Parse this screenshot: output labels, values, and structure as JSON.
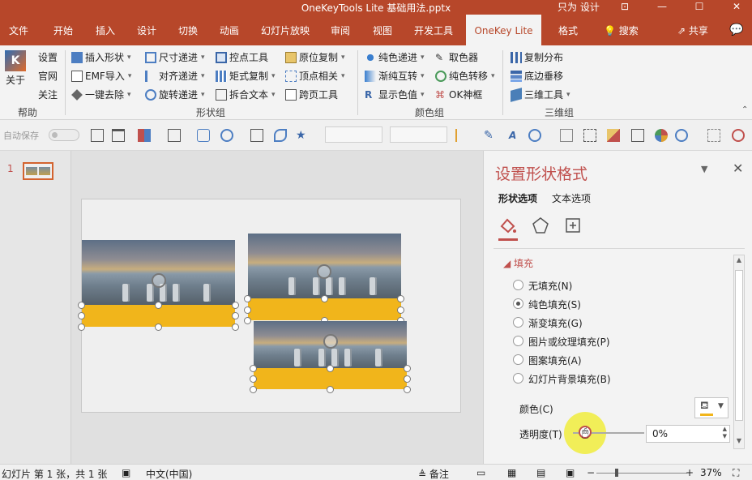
{
  "window": {
    "title": "OneKeyTools Lite 基础用法.pptx",
    "user": "只为 设计",
    "buttons": [
      "⊡",
      "—",
      "☐",
      "✕"
    ]
  },
  "tabs": [
    "文件",
    "开始",
    "插入",
    "设计",
    "切换",
    "动画",
    "幻灯片放映",
    "审阅",
    "视图",
    "开发工具",
    "OneKey Lite",
    "格式"
  ],
  "active_tab": "OneKey Lite",
  "tell_me": "搜索",
  "share": "共享",
  "ribbon": {
    "help_group": {
      "big_button": "关于",
      "items": [
        "设置",
        "官网",
        "关注"
      ],
      "label": "帮助"
    },
    "shape_group": {
      "col1": [
        "插入形状",
        "EMF导入",
        "一键去除"
      ],
      "col2": [
        "尺寸递进",
        "对齐递进",
        "旋转递进"
      ],
      "col3": [
        "控点工具",
        "矩式复制",
        "拆合文本"
      ],
      "col4": [
        "原位复制",
        "顶点相关",
        "跨页工具"
      ],
      "label": "形状组"
    },
    "color_group": {
      "col1": [
        "纯色递进",
        "渐纯互转",
        "显示色值"
      ],
      "col2": [
        "取色器",
        "纯色转移",
        "OK神框"
      ],
      "label": "颜色组"
    },
    "three_d_group": {
      "items": [
        "复制分布",
        "底边垂移",
        "三维工具"
      ],
      "label": "三维组"
    }
  },
  "qat": {
    "autosave_label": "自动保存"
  },
  "thumbnails": {
    "slide_number": "1"
  },
  "format_pane": {
    "title": "设置形状格式",
    "tabs": [
      "形状选项",
      "文本选项"
    ],
    "section": "填充",
    "fill_options": [
      {
        "label": "无填充(N)",
        "selected": false
      },
      {
        "label": "纯色填充(S)",
        "selected": true
      },
      {
        "label": "渐变填充(G)",
        "selected": false
      },
      {
        "label": "图片或纹理填充(P)",
        "selected": false
      },
      {
        "label": "图案填充(A)",
        "selected": false
      },
      {
        "label": "幻灯片背景填充(B)",
        "selected": false
      }
    ],
    "color_label": "颜色(C)",
    "transparency_label": "透明度(T)",
    "transparency_value": "0%"
  },
  "status": {
    "slide_info": "幻灯片 第 1 张，共 1 张",
    "language": "中文(中国)",
    "notes": "备注",
    "zoom": "37%"
  },
  "colors": {
    "accent": "#b7472a",
    "pane_title": "#c0504d",
    "band": "#f1b51b"
  }
}
